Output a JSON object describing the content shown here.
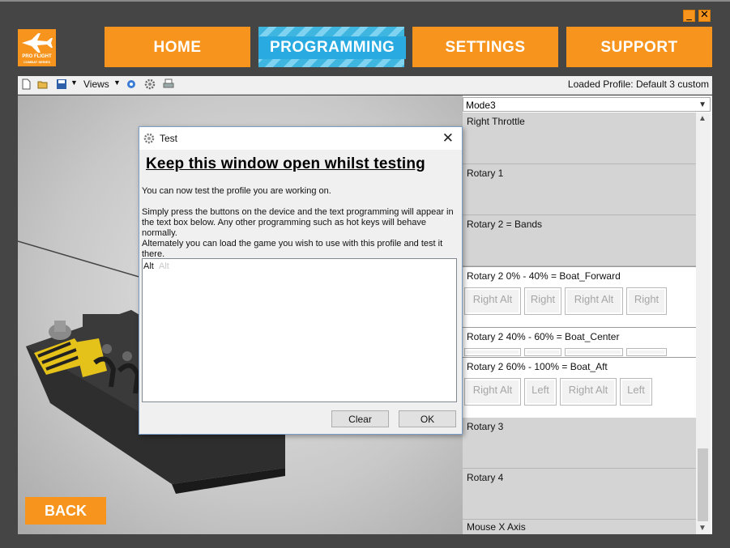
{
  "window": {
    "minimize_glyph": "_",
    "close_glyph": "✕"
  },
  "logo": {
    "line1": "PRO FLIGHT",
    "line2": "COMBAT SERIES"
  },
  "nav": {
    "home": "HOME",
    "programming": "PROGRAMMING",
    "settings": "SETTINGS",
    "support": "SUPPORT"
  },
  "toolbar": {
    "views_label": "Views",
    "loaded_profile": "Loaded Profile: Default 3 custom"
  },
  "mode_select": {
    "value": "Mode3"
  },
  "sections": {
    "right_throttle": "Right Throttle",
    "rotary1": "Rotary 1",
    "rotary2": "Rotary 2 = Bands",
    "band_forward": {
      "label": "Rotary 2 0% - 40% = Boat_Forward",
      "keys": [
        "Right Alt",
        "Right",
        "Right Alt",
        "Right"
      ]
    },
    "band_center": {
      "label": "Rotary 2 40% - 60% = Boat_Center"
    },
    "band_aft": {
      "label": "Rotary 2 60% - 100% = Boat_Aft",
      "keys": [
        "Right Alt",
        "Left",
        "Right Alt",
        "Left"
      ]
    },
    "rotary3": "Rotary 3",
    "rotary4": "Rotary 4",
    "mouse_x": "Mouse X Axis"
  },
  "back_label": "BACK",
  "dialog": {
    "title": "Test",
    "close_glyph": "✕",
    "heading": "Keep this window open whilst testing",
    "para1": "You can now test the profile you are working on.",
    "para2": "Simply press the buttons on the device and the text programming will appear in the text box below. Any other programming such as hot keys will behave normally.",
    "para3": "Altemately you can load the game you wish to use with this profile and test it there.",
    "output_current": "Alt",
    "output_faded": "Alt",
    "clear_label": "Clear",
    "ok_label": "OK"
  },
  "colors": {
    "accent": "#f7941d",
    "active_tab": "#29abe2"
  }
}
